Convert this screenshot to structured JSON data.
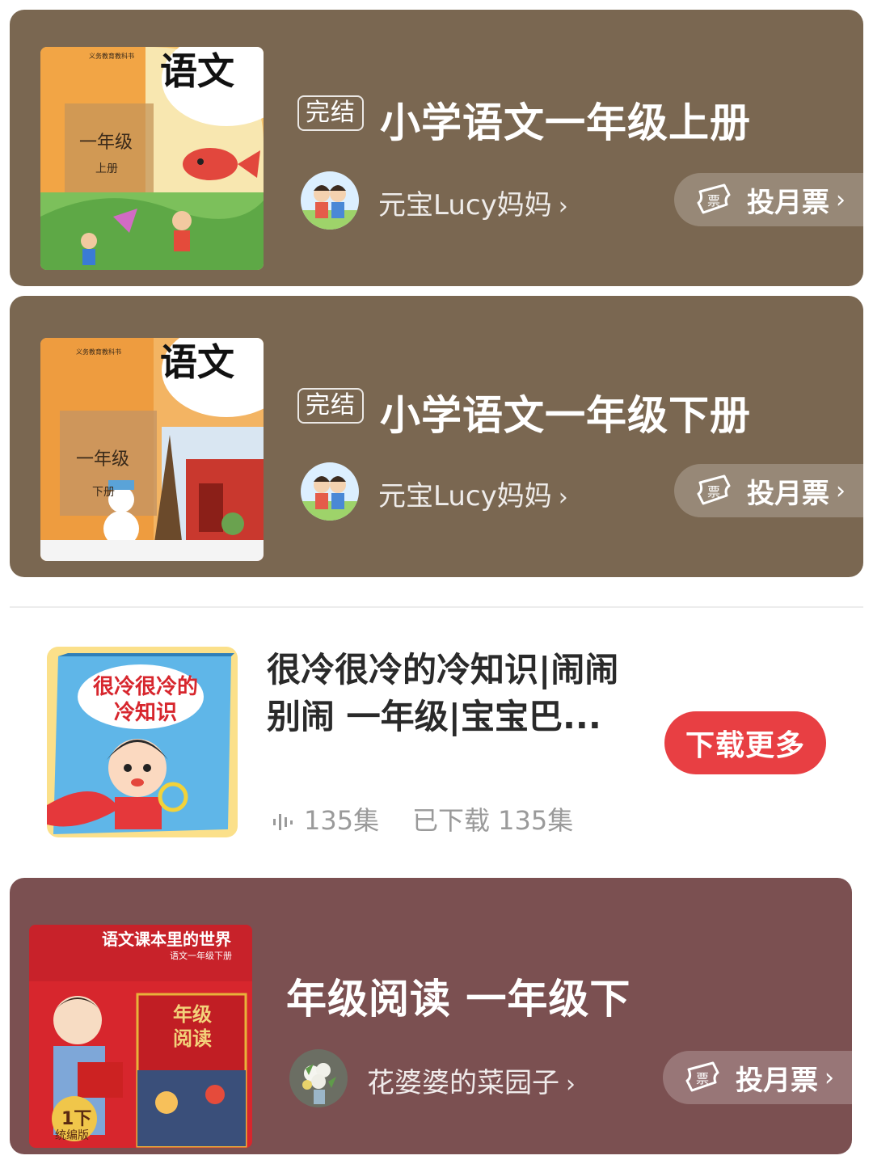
{
  "albums": [
    {
      "badge": "完结",
      "title": "小学语文一年级上册",
      "author": "元宝Lucy妈妈",
      "vote_label": "投月票",
      "cover": {
        "brand": "语文",
        "grade": "一年级",
        "volume": "上册",
        "series": "义务教育教科书"
      }
    },
    {
      "badge": "完结",
      "title": "小学语文一年级下册",
      "author": "元宝Lucy妈妈",
      "vote_label": "投月票",
      "cover": {
        "brand": "语文",
        "grade": "一年级",
        "volume": "下册",
        "series": "义务教育教科书"
      }
    }
  ],
  "download_item": {
    "title": "很冷很冷的冷知识|闹闹别闹 一年级|宝宝巴...",
    "episodes": "135集",
    "downloaded": "已下载 135集",
    "button_label": "下载更多",
    "cover_text": "很冷很冷的冷知识"
  },
  "recommend": {
    "title": "年级阅读 一年级下",
    "author": "花婆婆的菜园子",
    "vote_label": "投月票",
    "cover": {
      "top": "语文课本里的世界",
      "sub": "语文一年级下册",
      "book": "年级阅读",
      "edition_num": "1下",
      "edition": "统编版"
    }
  },
  "colors": {
    "card_brown": "#7a6751",
    "card_maroon": "#7b5051",
    "download_red": "#e83f43"
  },
  "icons": {
    "vote": "ticket-icon",
    "chevron": "chevron-right-icon",
    "audio": "audio-wave-icon"
  }
}
